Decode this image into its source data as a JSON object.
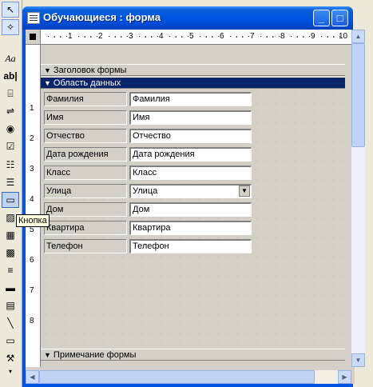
{
  "window": {
    "title": "Обучающиеся : форма",
    "minimize_glyph": "_",
    "maximize_glyph": "□",
    "close_glyph": "×"
  },
  "toolbox": {
    "tooltip": "Кнопка",
    "tools": [
      {
        "name": "select-objects-icon",
        "glyph": "↖"
      },
      {
        "name": "control-wizards-icon",
        "glyph": "✧"
      },
      {
        "name": "label-tool-icon",
        "glyph": "Aa"
      },
      {
        "name": "textbox-tool-icon",
        "glyph": "ab|"
      },
      {
        "name": "option-group-icon",
        "glyph": "⌸"
      },
      {
        "name": "toggle-button-icon",
        "glyph": "⇌"
      },
      {
        "name": "option-button-icon",
        "glyph": "◉"
      },
      {
        "name": "checkbox-tool-icon",
        "glyph": "☑"
      },
      {
        "name": "combobox-tool-icon",
        "glyph": "☷"
      },
      {
        "name": "listbox-tool-icon",
        "glyph": "☰"
      },
      {
        "name": "command-button-icon",
        "glyph": "▭"
      },
      {
        "name": "image-tool-icon",
        "glyph": "▨"
      },
      {
        "name": "unbound-frame-icon",
        "glyph": "▦"
      },
      {
        "name": "bound-frame-icon",
        "glyph": "▩"
      },
      {
        "name": "page-break-icon",
        "glyph": "≡"
      },
      {
        "name": "tab-control-icon",
        "glyph": "▬"
      },
      {
        "name": "subform-icon",
        "glyph": "▤"
      },
      {
        "name": "line-tool-icon",
        "glyph": "╲"
      },
      {
        "name": "rectangle-tool-icon",
        "glyph": "▭"
      },
      {
        "name": "more-controls-icon",
        "glyph": "⚒"
      }
    ]
  },
  "ruler": {
    "h_numbers": [
      "1",
      "2",
      "3",
      "4",
      "5",
      "6",
      "7",
      "8",
      "9",
      "10"
    ],
    "v_numbers": [
      "1",
      "2",
      "3",
      "4",
      "5",
      "6",
      "7",
      "8"
    ]
  },
  "sections": {
    "header": "Заголовок формы",
    "detail": "Область данных",
    "footer": "Примечание формы"
  },
  "fields": [
    {
      "label": "Фамилия",
      "value": "Фамилия"
    },
    {
      "label": "Имя",
      "value": "Имя"
    },
    {
      "label": "Отчество",
      "value": "Отчество"
    },
    {
      "label": "Дата рождения",
      "value": "Дата рождения"
    },
    {
      "label": "Класс",
      "value": "Класс"
    },
    {
      "label": "Улица",
      "value": "Улица"
    },
    {
      "label": "Дом",
      "value": "Дом"
    },
    {
      "label": "Квартира",
      "value": "Квартира"
    },
    {
      "label": "Телефон",
      "value": "Телефон"
    }
  ]
}
